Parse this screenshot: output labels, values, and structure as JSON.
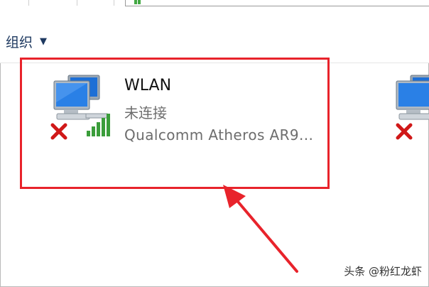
{
  "toolbar": {
    "organize_label": "组织",
    "organize_caret": "▼"
  },
  "adapter": {
    "name": "WLAN",
    "status": "未连接",
    "device": "Qualcomm Atheros AR9..."
  },
  "annotation": {
    "highlight_color": "#e8232b",
    "arrow_color": "#e8232b"
  },
  "watermark": "头条 @粉红龙虾"
}
